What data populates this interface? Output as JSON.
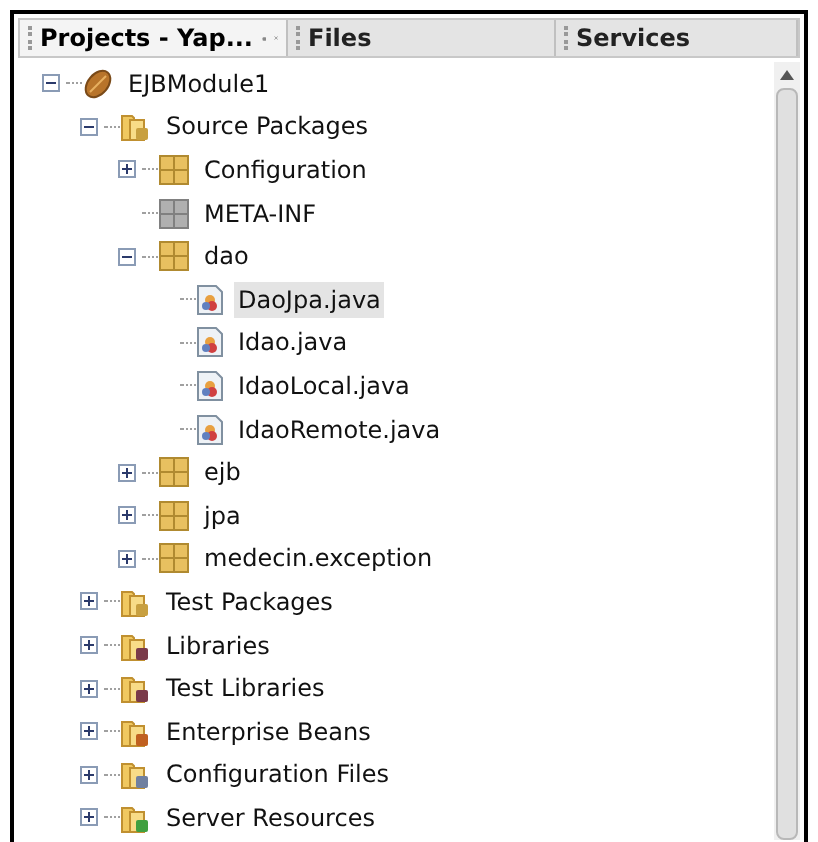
{
  "tabs": [
    {
      "label": "Projects - Yap...",
      "selected": true
    },
    {
      "label": "Files",
      "selected": false
    },
    {
      "label": "Services",
      "selected": false
    }
  ],
  "tree": [
    {
      "label": "EJBModule1",
      "kind": "project",
      "expanded": true,
      "children": [
        {
          "label": "Source Packages",
          "kind": "source-folder",
          "expanded": true,
          "children": [
            {
              "label": "Configuration",
              "kind": "package",
              "expanded": false
            },
            {
              "label": "META-INF",
              "kind": "empty-package"
            },
            {
              "label": "dao",
              "kind": "package",
              "expanded": true,
              "children": [
                {
                  "label": "DaoJpa.java",
                  "kind": "java",
                  "selected": true
                },
                {
                  "label": "Idao.java",
                  "kind": "java",
                  "selected": false
                },
                {
                  "label": "IdaoLocal.java",
                  "kind": "java",
                  "selected": false
                },
                {
                  "label": "IdaoRemote.java",
                  "kind": "java",
                  "selected": false
                }
              ]
            },
            {
              "label": "ejb",
              "kind": "package",
              "expanded": false
            },
            {
              "label": "jpa",
              "kind": "package",
              "expanded": false
            },
            {
              "label": "medecin.exception",
              "kind": "package",
              "expanded": false
            }
          ]
        },
        {
          "label": "Test Packages",
          "kind": "source-folder",
          "expanded": false
        },
        {
          "label": "Libraries",
          "kind": "library-folder",
          "expanded": false
        },
        {
          "label": "Test Libraries",
          "kind": "library-folder",
          "expanded": false
        },
        {
          "label": "Enterprise Beans",
          "kind": "beans-folder",
          "expanded": false
        },
        {
          "label": "Configuration Files",
          "kind": "config-folder",
          "expanded": false
        },
        {
          "label": "Server Resources",
          "kind": "server-folder",
          "expanded": false
        }
      ]
    }
  ]
}
